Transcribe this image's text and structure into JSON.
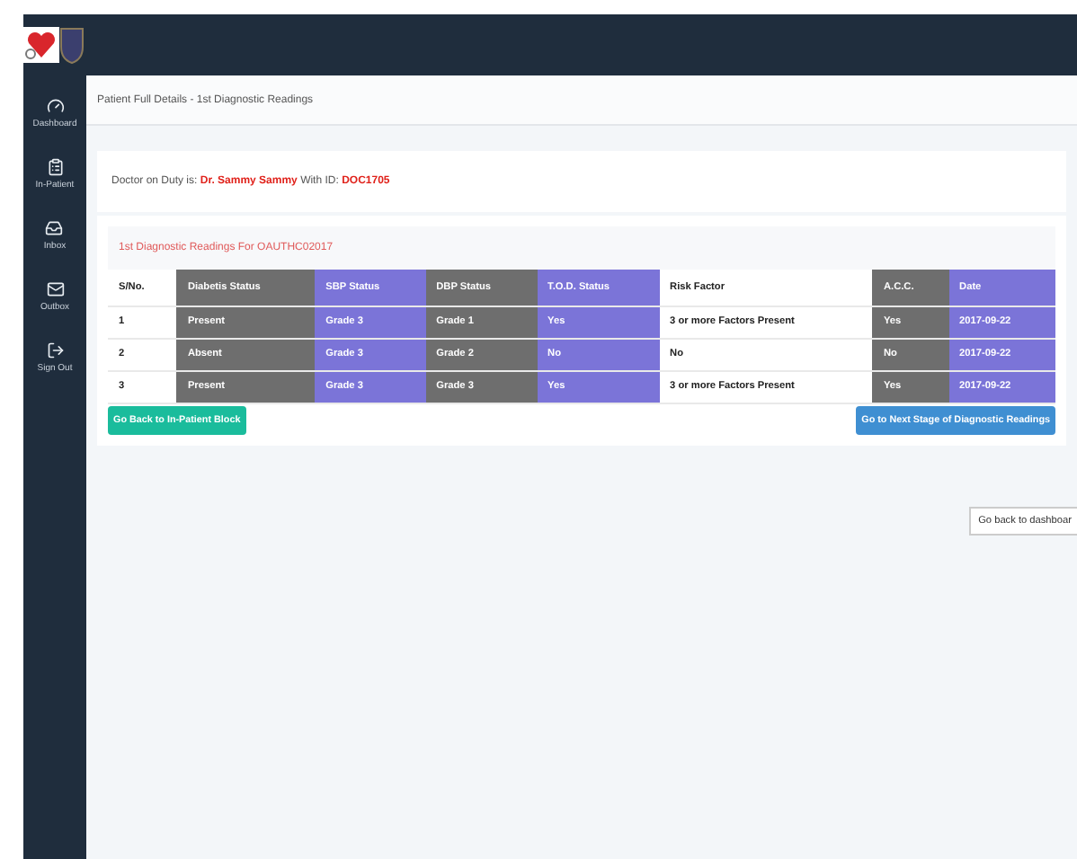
{
  "sidebar": {
    "items": [
      {
        "label": "Dashboard"
      },
      {
        "label": "In-Patient"
      },
      {
        "label": "Inbox"
      },
      {
        "label": "Outbox"
      },
      {
        "label": "Sign Out"
      }
    ]
  },
  "breadcrumb": "Patient Full Details - 1st Diagnostic Readings",
  "doctor": {
    "prefix": "Doctor on Duty is:",
    "name": "Dr. Sammy Sammy",
    "id_label": "With ID:",
    "id": "DOC1705"
  },
  "panel_title": "1st Diagnostic Readings For OAUTHC02017",
  "table": {
    "columns": [
      {
        "label": "S/No.",
        "kind": "plain"
      },
      {
        "label": "Diabetis Status",
        "kind": "dark"
      },
      {
        "label": "SBP Status",
        "kind": "accent"
      },
      {
        "label": "DBP Status",
        "kind": "dark"
      },
      {
        "label": "T.O.D. Status",
        "kind": "accent"
      },
      {
        "label": "Risk Factor",
        "kind": "plain"
      },
      {
        "label": "A.C.C.",
        "kind": "dark"
      },
      {
        "label": "Date",
        "kind": "accent"
      }
    ],
    "rows": [
      [
        "1",
        "Present",
        "Grade 3",
        "Grade 1",
        "Yes",
        "3 or more Factors Present",
        "Yes",
        "2017-09-22"
      ],
      [
        "2",
        "Absent",
        "Grade 3",
        "Grade 2",
        "No",
        "No",
        "No",
        "2017-09-22"
      ],
      [
        "3",
        "Present",
        "Grade 3",
        "Grade 3",
        "Yes",
        "3 or more Factors Present",
        "Yes",
        "2017-09-22"
      ]
    ]
  },
  "back_button": "Go Back to In-Patient Block",
  "next_button": "Go to Next Stage of Diagnostic Readings",
  "dashboard_button": "Go back to dashboar"
}
